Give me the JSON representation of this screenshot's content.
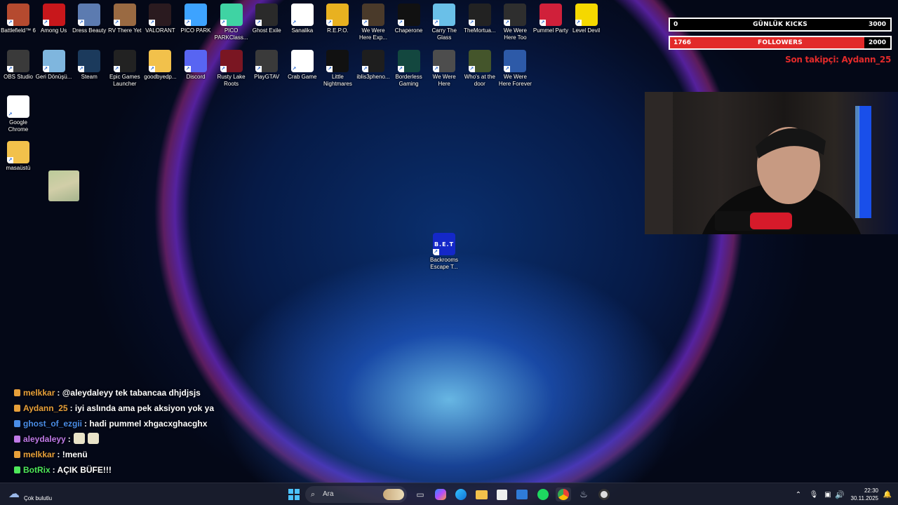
{
  "desktop_icons_row1": [
    {
      "label": "Battlefield™ 6",
      "color": "#b54a2f"
    },
    {
      "label": "Among Us",
      "color": "#c8171b"
    },
    {
      "label": "Dress Beauty",
      "color": "#5c7bb0"
    },
    {
      "label": "RV There Yet",
      "color": "#9a6a42"
    },
    {
      "label": "VALORANT",
      "color": "#2a1a1f"
    },
    {
      "label": "PICO PARK",
      "color": "#3da3ff"
    },
    {
      "label": "PICO PARKClass...",
      "color": "#3fd3a3"
    },
    {
      "label": "Ghost Exile",
      "color": "#2a2a2a"
    },
    {
      "label": "Sanalika",
      "color": "#ffffff"
    },
    {
      "label": "R.E.P.O.",
      "color": "#e8b120"
    },
    {
      "label": "We Were Here Exp...",
      "color": "#4a3a2a"
    },
    {
      "label": "Chaperone",
      "color": "#111111"
    },
    {
      "label": "Carry The Glass",
      "color": "#6ac0e8"
    },
    {
      "label": "TheMortua...",
      "color": "#222222"
    },
    {
      "label": "We Were Here Too",
      "color": "#2e2e2e"
    },
    {
      "label": "Pummel Party",
      "color": "#d0203a"
    },
    {
      "label": "Level Devil",
      "color": "#f5d800"
    }
  ],
  "desktop_icons_row2": [
    {
      "label": "OBS Studio",
      "color": "#3a3a3a"
    },
    {
      "label": "Geri Dönüşü...",
      "color": "#7fb6de"
    },
    {
      "label": "Steam",
      "color": "#1b3a5c"
    },
    {
      "label": "Epic Games Launcher",
      "color": "#222222"
    },
    {
      "label": "goodbyedp...",
      "color": "#f2c14b"
    },
    {
      "label": "Discord",
      "color": "#5865f2"
    },
    {
      "label": "Rusty Lake Roots",
      "color": "#7a1622"
    },
    {
      "label": "PlayGTAV",
      "color": "#3a3a3a"
    },
    {
      "label": "Crab Game",
      "color": "#ffffff"
    },
    {
      "label": "Little Nightmares",
      "color": "#111111"
    },
    {
      "label": "iblis3pheno...",
      "color": "#1e1e1e"
    },
    {
      "label": "Borderless Gaming",
      "color": "#13473f"
    },
    {
      "label": "We Were Here",
      "color": "#4d4d4d"
    },
    {
      "label": "Who's at the door",
      "color": "#44552b"
    },
    {
      "label": "We Were Here Forever",
      "color": "#2d5aa8"
    }
  ],
  "desktop_icons_col": [
    {
      "label": "Google Chrome",
      "color": "#ffffff"
    },
    {
      "label": "masaüstü",
      "color": "#f2c14b"
    }
  ],
  "center_icon": {
    "label": "Backrooms Escape T...",
    "tile_text": "B.E.T",
    "color": "#1428c8"
  },
  "stream_goals": {
    "kicks": {
      "current": "0",
      "title": "GÜNLÜK KICKS",
      "goal": "3000",
      "progress": 0
    },
    "followers": {
      "current": "1766",
      "title": "FOLLOWERS",
      "goal": "2000",
      "progress": 0.883
    },
    "last_follower": "Son takipçi: Aydann_25",
    "accent_color": "#e22a2a"
  },
  "chat": [
    {
      "user": "melkkar",
      "user_color": "#e8a03a",
      "text": ": @aleydaleyy tek tabancaa dhjdjsjs"
    },
    {
      "user": "Aydann_25",
      "user_color": "#e8a03a",
      "text": ": iyi aslında ama pek aksiyon yok ya"
    },
    {
      "user": "ghost_of_ezgii",
      "user_color": "#4a8de8",
      "text": ": hadi pummel xhgacxghacghx"
    },
    {
      "user": "aleydaleyy",
      "user_color": "#c07ae8",
      "text": ":"
    },
    {
      "user": "melkkar",
      "user_color": "#e8a03a",
      "text": ": !menü"
    },
    {
      "user": "BotRix",
      "user_color": "#4ee85a",
      "text": ": AÇIK BÜFE!!!"
    }
  ],
  "taskbar": {
    "weather_text": "Çok bulutlu",
    "search_placeholder": "Ara",
    "time": "22:30",
    "date": "30.11.2025"
  }
}
